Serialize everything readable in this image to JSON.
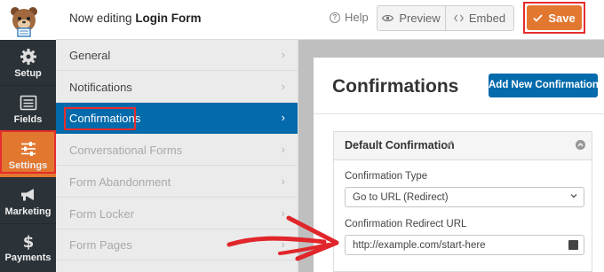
{
  "header": {
    "editing_prefix": "Now editing",
    "form_name": "Login Form",
    "help_label": "Help",
    "preview_label": "Preview",
    "embed_label": "Embed",
    "save_label": "Save"
  },
  "sidebar": {
    "items": [
      {
        "label": "Setup",
        "icon": "gear-icon"
      },
      {
        "label": "Fields",
        "icon": "fields-icon"
      },
      {
        "label": "Settings",
        "icon": "sliders-icon",
        "active": true
      },
      {
        "label": "Marketing",
        "icon": "megaphone-icon"
      },
      {
        "label": "Payments",
        "icon": "dollar-icon"
      }
    ]
  },
  "settings_panel": {
    "items": [
      {
        "label": "General"
      },
      {
        "label": "Notifications"
      },
      {
        "label": "Confirmations",
        "active": true
      },
      {
        "label": "Conversational Forms",
        "disabled": true
      },
      {
        "label": "Form Abandonment",
        "disabled": true
      },
      {
        "label": "Form Locker",
        "disabled": true
      },
      {
        "label": "Form Pages",
        "disabled": true
      }
    ]
  },
  "main": {
    "title": "Confirmations",
    "add_button": "Add New Confirmation",
    "confirmation": {
      "title": "Default Confirmation",
      "type_label": "Confirmation Type",
      "type_value": "Go to URL (Redirect)",
      "redirect_label": "Confirmation Redirect URL",
      "redirect_value": "http://example.com/start-here"
    }
  },
  "colors": {
    "accent_orange": "#e27730",
    "primary_blue": "#036aab",
    "sidebar_dark": "#2c3338",
    "highlight_red": "#e52d2d"
  }
}
